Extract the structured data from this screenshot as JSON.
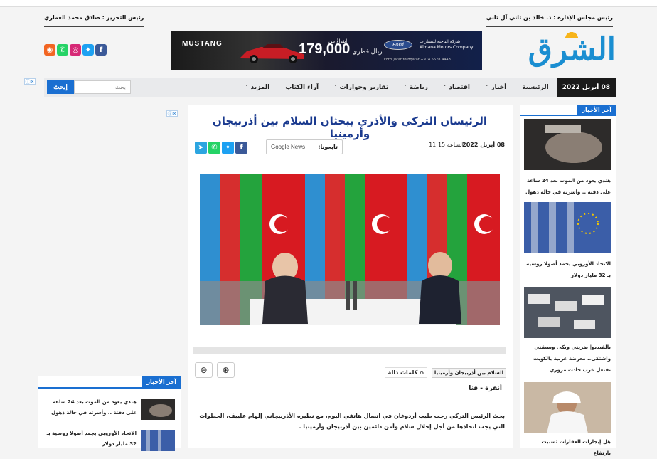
{
  "masthead": {
    "chairman": "رئيس مجلس الإدارة : د. خالد بن ثاني آل ثاني",
    "editor": "رئيس التحرير : صادق محمد العماري",
    "logo_text": "الشرق"
  },
  "social": {
    "icons": [
      "facebook-icon",
      "twitter-icon",
      "instagram-icon",
      "whatsapp-icon",
      "rss-icon"
    ]
  },
  "ad": {
    "brand": "MUSTANG",
    "price_label": "ابتداءً من",
    "price": "179,000",
    "currency": "ريال قطري",
    "maker": "Ford",
    "dealer": "شركة الناخبة للسيارات",
    "dealer_en": "Almana Motors Company",
    "footer": "FordQatar   fordqatar   +974 5578 4448"
  },
  "adchoices": "ⓘ✕",
  "nav": {
    "date": "08 أبريل 2022",
    "items": [
      {
        "label": "الرئيسية",
        "has_menu": false
      },
      {
        "label": "أخبار",
        "has_menu": true
      },
      {
        "label": "اقتصاد",
        "has_menu": true
      },
      {
        "label": "رياضة",
        "has_menu": true
      },
      {
        "label": "تقارير وحوارات",
        "has_menu": true
      },
      {
        "label": "آراء الكتاب",
        "has_menu": false
      },
      {
        "label": "المزيد",
        "has_menu": true
      }
    ],
    "chevron": "˅",
    "search_placeholder": "بحث",
    "search_button": "إبحث"
  },
  "article": {
    "title": "الرئيسان التركي والأذري يبحثان السلام بين أذربيجان وأرمينيا",
    "date": "08 أبريل 2022",
    "time": "الساعة 11:15",
    "follow_label": "تابعونا:",
    "google_news": "Google News",
    "tags_label": "كلمات دالة",
    "tags": [
      "السلام بين أذربيجان وأرمينيا"
    ],
    "dateline": "أنقرة - قنا",
    "para1": "بحث الرئيس التركي رجب طيب أردوغان في اتصال هاتفي اليوم، مع نظيره الأذربيجاني إلهام علييف، الخطوات التي يجب اتخاذها من أجل إحلال سلام وأمن دائمين بين أذربيجان وأرمينيا .",
    "zoom_out": "⊖",
    "zoom_in": "⊕"
  },
  "latest": {
    "header": "آخر الأخبار",
    "items": [
      {
        "title": "هندي يعود من الموت بعد 24 ساعة على دفنة .. وأسرته في حالة ذهول"
      },
      {
        "title": "الاتحاد الأوروبي يجمد أصولا روسية بـ 32 مليار دولار"
      },
      {
        "title": "بالفيديو| ضربني وبكى وسبقني واشتكى.. معرضة عربية بالكويت تفتعل غرب حادث مروري"
      },
      {
        "title": "هل إيجارات العقارات تسببت بارتفاع"
      }
    ]
  },
  "left_latest": {
    "header": "آخر الأخبار",
    "items": [
      {
        "title": "هندي يعود من الموت بعد 24 ساعة على دفنة .. وأسرته في حالة ذهول"
      },
      {
        "title": "الاتحاد الأوروبي يجمد أصولا روسية بـ 32 مليار دولار"
      }
    ]
  }
}
